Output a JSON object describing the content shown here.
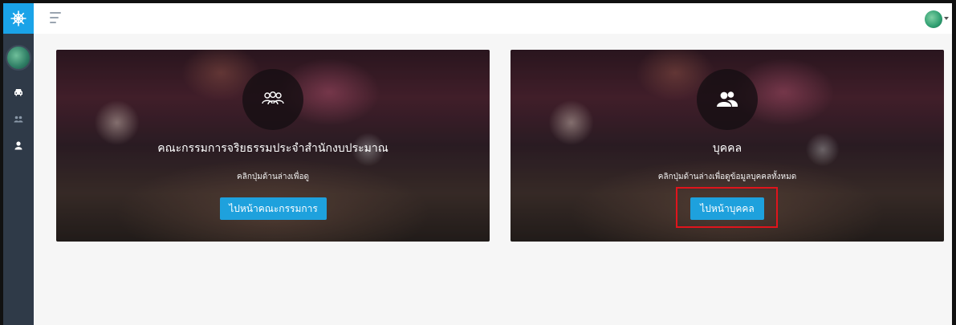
{
  "cards": [
    {
      "icon": "group-icon",
      "title": "คณะกรรมการจริยธรรมประจำสำนักงบประมาณ",
      "subtitle": "คลิกปุ่มด้านล่างเพื่อดู",
      "button_label": "ไปหน้าคณะกรรมการ"
    },
    {
      "icon": "users-icon",
      "title": "บุคคล",
      "subtitle": "คลิกปุ่มด้านล่างเพื่อดูข้อมูลบุคคลทั้งหมด",
      "button_label": "ไปหน้าบุคคล"
    }
  ],
  "sidebar": {
    "items": [
      {
        "icon": "car-icon"
      },
      {
        "icon": "people-icon"
      },
      {
        "icon": "user-icon"
      }
    ]
  },
  "colors": {
    "sidebar": "#2f3a48",
    "brand": "#1aa3e8",
    "button": "#1ea1dd",
    "highlight": "#e0141c"
  }
}
